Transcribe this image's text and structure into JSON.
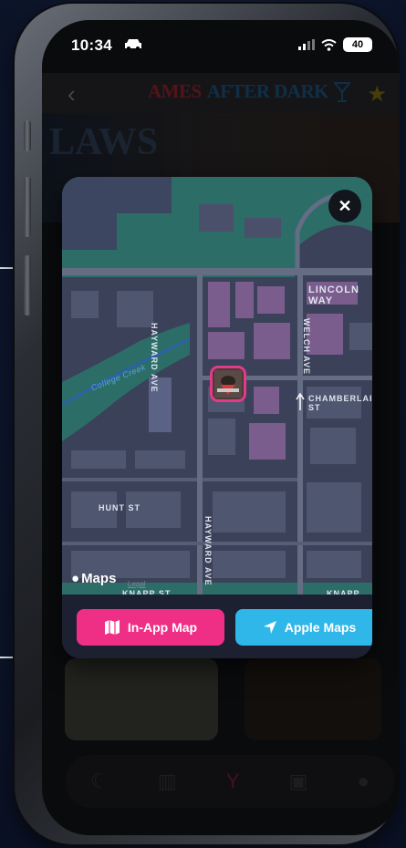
{
  "status_bar": {
    "time": "10:34",
    "battery": "40"
  },
  "header": {
    "logo_left": "AMES",
    "logo_right": "AFTER DARK"
  },
  "hero": {
    "text": "LAWS"
  },
  "map": {
    "streets": {
      "lincoln_way": "LINCOLN WAY",
      "chamberlain": "CHAMBERLAIN ST",
      "hayward_top": "HAYWARD AVE",
      "hayward_bottom": "HAYWARD AVE",
      "welch": "WELCH AVE",
      "hunt": "HUNT ST",
      "knapp_left": "KNAPP ST",
      "knapp_right": "KNAPP ST",
      "college_creek": "College Creek"
    },
    "attribution": "Maps",
    "legal": "Legal",
    "marker_icon": "venue-logo-marker"
  },
  "buttons": {
    "in_app_map": "In-App Map",
    "apple_maps": "Apple Maps"
  },
  "colors": {
    "in_app_button": "#ef2f86",
    "apple_button": "#2fb7e9",
    "marker_border": "#e23a86"
  }
}
